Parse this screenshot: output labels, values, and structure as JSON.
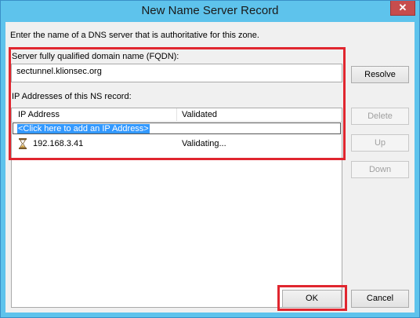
{
  "window": {
    "title": "New Name Server Record",
    "close_label": "✕"
  },
  "intro_text": "Enter the name of a DNS server that is authoritative for this zone.",
  "fqdn": {
    "label": "Server fully qualified domain name (FQDN):",
    "value": "sectunnel.klionsec.org"
  },
  "resolve_label": "Resolve",
  "ip_section": {
    "label": "IP Addresses of this NS record:"
  },
  "table": {
    "columns": [
      "IP Address",
      "Validated"
    ],
    "add_row_text": "<Click here to add an IP Address>",
    "rows": [
      {
        "ip": "192.168.3.41",
        "status": "Validating..."
      }
    ]
  },
  "side_buttons": {
    "delete": "Delete",
    "up": "Up",
    "down": "Down"
  },
  "footer": {
    "ok": "OK",
    "cancel": "Cancel"
  },
  "colors": {
    "title_bar": "#5ec3ec",
    "highlight_red": "#e0262f",
    "selection": "#3399ff"
  }
}
